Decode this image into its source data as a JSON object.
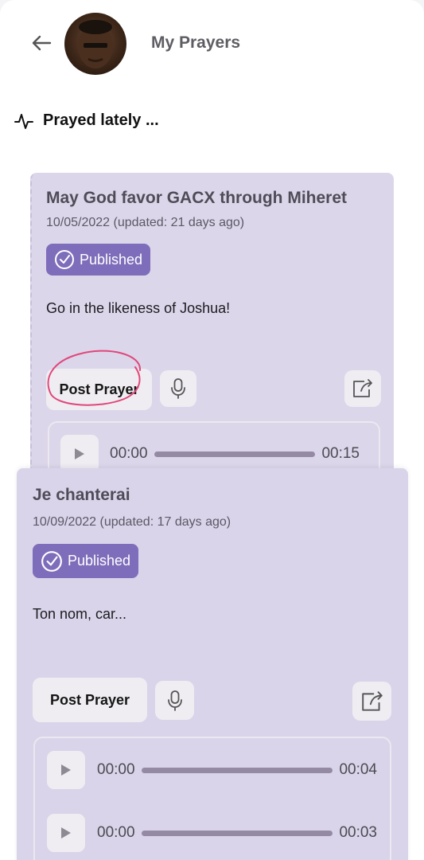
{
  "header": {
    "title": "My Prayers",
    "back_icon": "arrow-left-icon",
    "avatar_icon": "user-avatar"
  },
  "section": {
    "title": "Prayed lately ...",
    "icon": "activity-pulse-icon"
  },
  "cards": [
    {
      "title": "May God favor GACX through Miheret",
      "date": "10/05/2022 (updated: 21 days ago)",
      "status": "Published",
      "body": "Go in the likeness of Joshua!",
      "post_label": "Post Prayer",
      "audio": [
        {
          "current": "00:00",
          "duration": "00:15"
        }
      ]
    },
    {
      "title": "Je chanterai",
      "date": "10/09/2022 (updated: 17 days ago)",
      "status": "Published",
      "body": "Ton nom, car...",
      "post_label": "Post Prayer",
      "audio": [
        {
          "current": "00:00",
          "duration": "00:04"
        },
        {
          "current": "00:00",
          "duration": "00:03"
        }
      ]
    }
  ],
  "colors": {
    "card_bg": "#dcd6ea",
    "badge_bg": "#7e6dba",
    "progress_bar": "#958aa4",
    "highlight_ring": "#e0477a"
  }
}
